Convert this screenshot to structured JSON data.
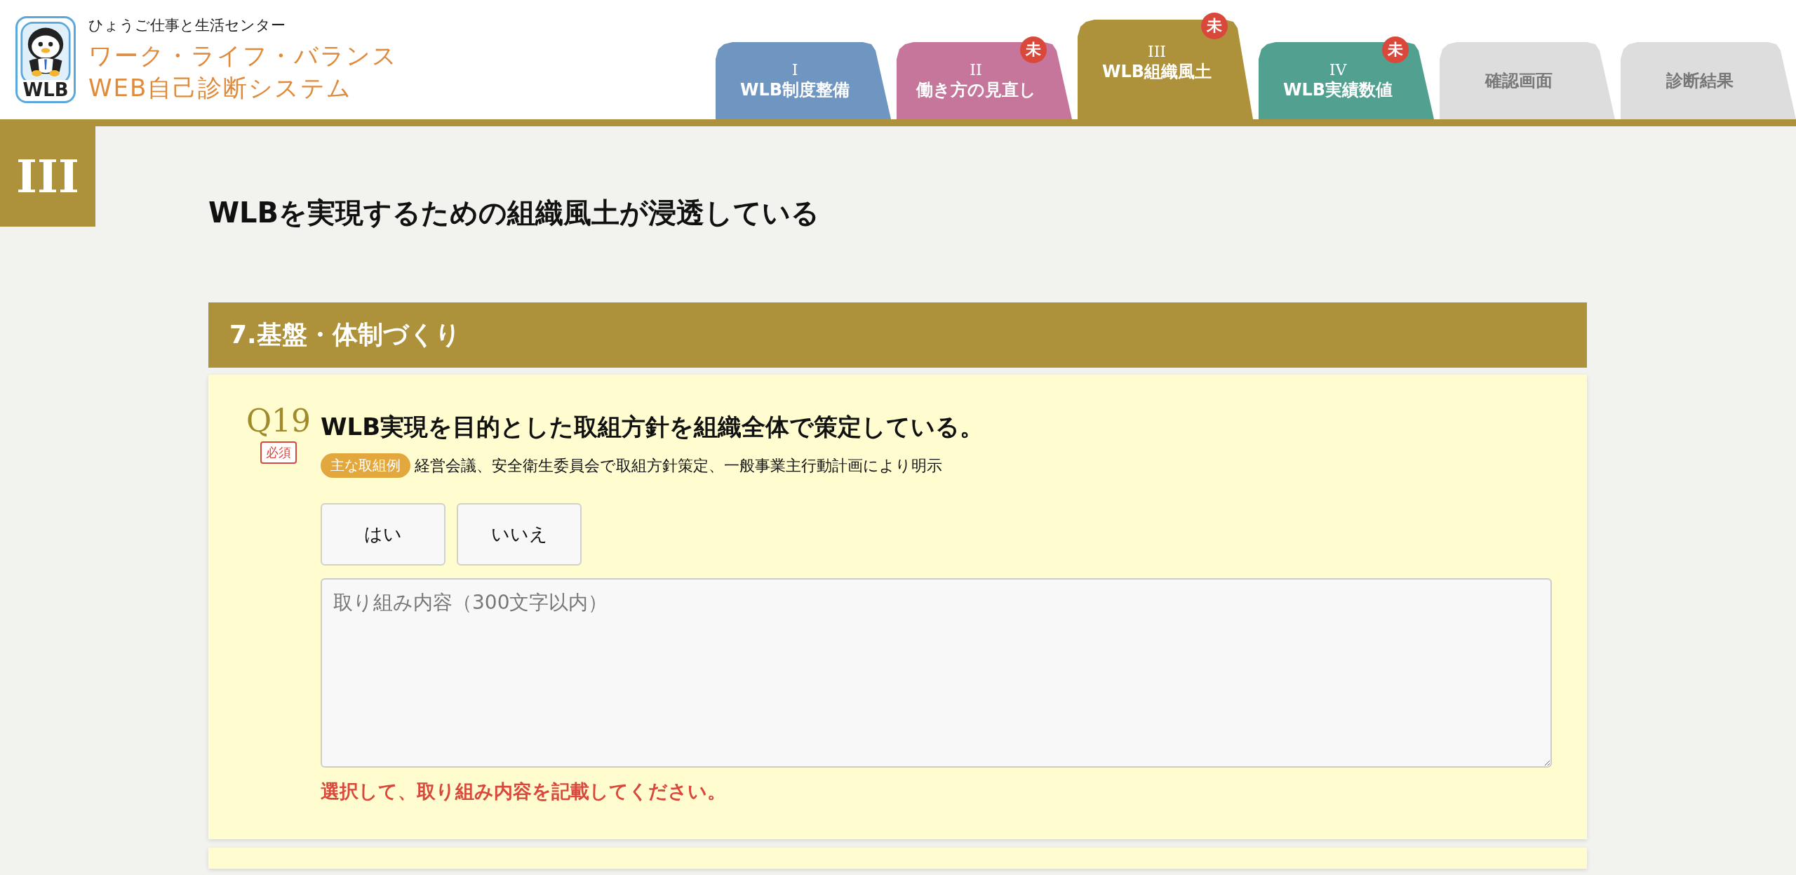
{
  "header": {
    "org": "ひょうご仕事と生活センター",
    "title_line1": "ワーク・ライフ・バランス",
    "title_line2": "WEB自己診断システム",
    "logo_text": "WLB"
  },
  "tabs": [
    {
      "numeral": "I",
      "label": "WLB制度整備",
      "selected": false,
      "color": "#6f95c1"
    },
    {
      "numeral": "II",
      "label": "働き方の見直し",
      "selected": false,
      "color": "#c6769b",
      "badge": "未"
    },
    {
      "numeral": "III",
      "label": "WLB組織風土",
      "selected": true,
      "color": "#ae923b",
      "badge": "未"
    },
    {
      "numeral": "IV",
      "label": "WLB実績数値",
      "selected": false,
      "color": "#52a08f",
      "badge": "未"
    },
    {
      "label": "確認画面",
      "selected": false,
      "color": "#dddddd"
    },
    {
      "label": "診断結果",
      "selected": false,
      "color": "#dddddd"
    }
  ],
  "section": {
    "numeral": "III",
    "heading": "WLBを実現するための組織風土が浸透している"
  },
  "category": "7.基盤・体制づくり",
  "question": {
    "number": "Q19",
    "required": "必須",
    "text": "WLB実現を目的とした取組方針を組織全体で策定している。",
    "example_label": "主な取組例",
    "example": "経営会議、安全衛生委員会で取組方針策定、一般事業主行動計画により明示",
    "answers": [
      {
        "label": "はい",
        "selected": false
      },
      {
        "label": "いいえ",
        "selected": false
      }
    ],
    "placeholder": "取り組み内容（300文字以内）",
    "error": "選択して、取り組み内容を記載してください。"
  }
}
